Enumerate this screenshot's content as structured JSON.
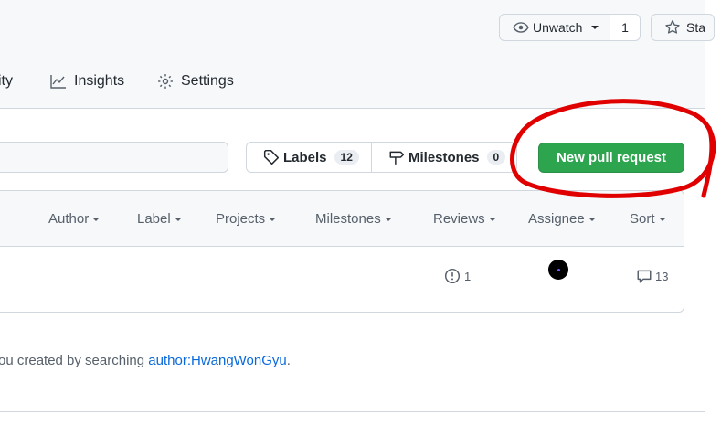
{
  "header": {
    "unwatch_label": "Unwatch",
    "unwatch_count": "1",
    "star_label": "Sta",
    "tabs": [
      {
        "label": "ity"
      },
      {
        "label": "Insights"
      },
      {
        "label": "Settings"
      }
    ]
  },
  "toolbar": {
    "labels_label": "Labels",
    "labels_count": "12",
    "milestones_label": "Milestones",
    "milestones_count": "0",
    "new_pr_label": "New pull request"
  },
  "filters": [
    "Author",
    "Label",
    "Projects",
    "Milestones",
    "Reviews",
    "Assignee",
    "Sort"
  ],
  "row": {
    "linked_issues_count": "1",
    "comments_count": "13"
  },
  "hint": {
    "prefix": "ou created by searching ",
    "link": "author:HwangWonGyu",
    "suffix": "."
  },
  "colors": {
    "primary_green": "#2da44e",
    "link_blue": "#0969da",
    "annotation_red": "#e00000"
  }
}
